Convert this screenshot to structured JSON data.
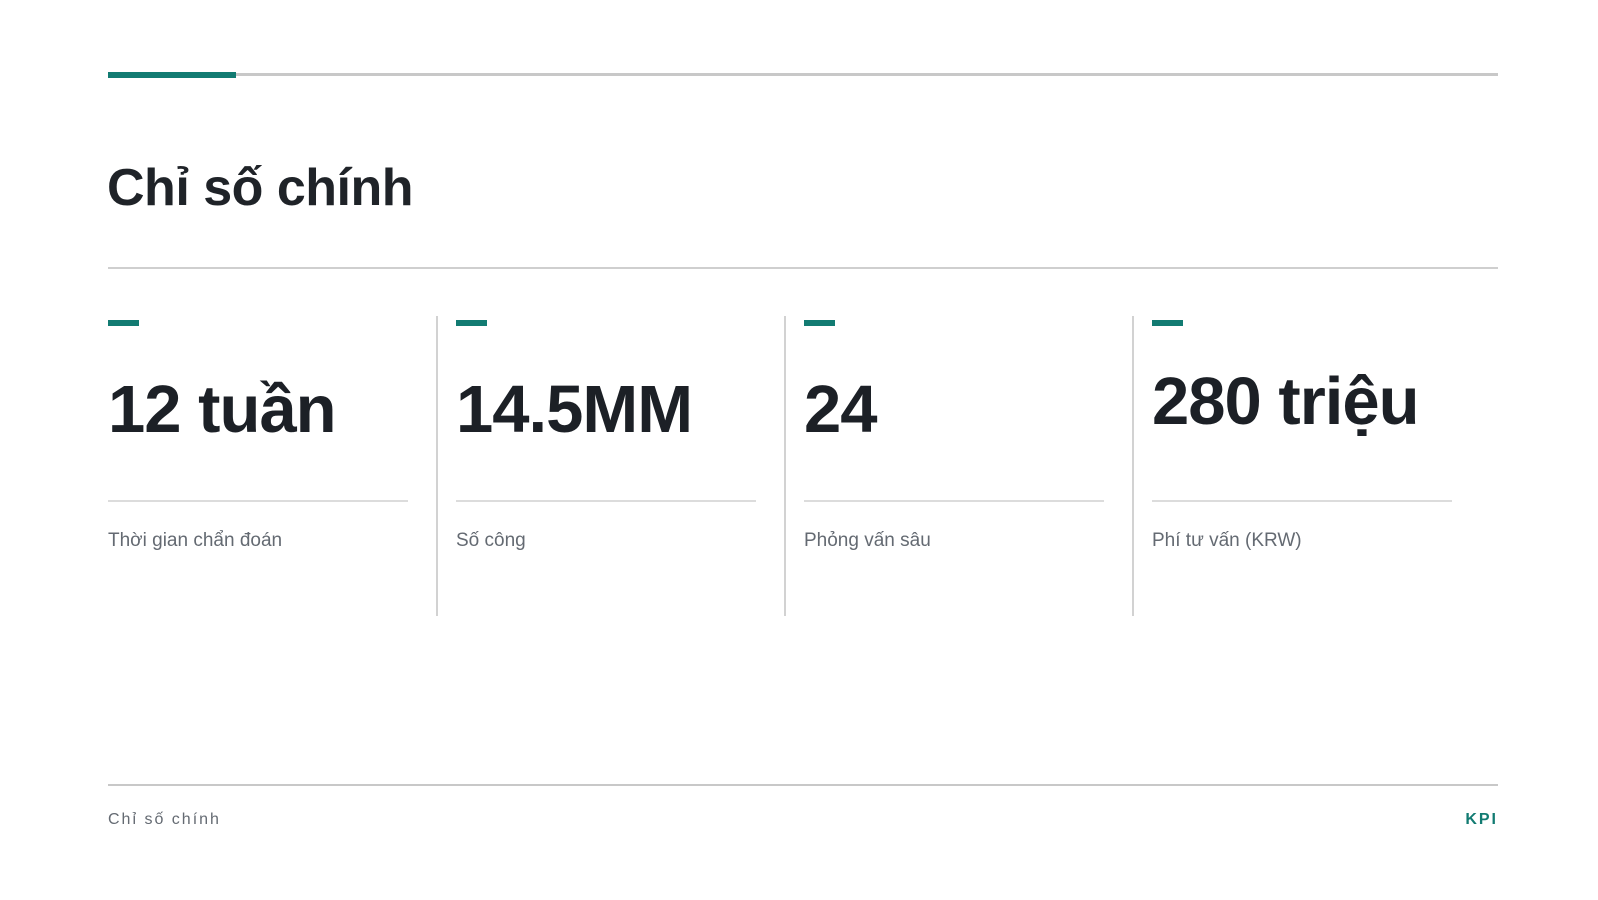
{
  "slide": {
    "title": "Chỉ số chính"
  },
  "kpis": [
    {
      "value": "12 tuần",
      "label": "Thời gian chẩn đoán"
    },
    {
      "value": "14.5MM",
      "label": "Số công"
    },
    {
      "value": "24",
      "label": "Phỏng vấn sâu"
    },
    {
      "value": "280 triệu",
      "label": "Phí tư vấn (KRW)"
    }
  ],
  "footer": {
    "section": "Chỉ số chính",
    "tag": "KPI"
  },
  "colors": {
    "accent": "#127b72",
    "text": "#1f2328",
    "muted": "#646a72",
    "rule": "#c8c8c8"
  }
}
